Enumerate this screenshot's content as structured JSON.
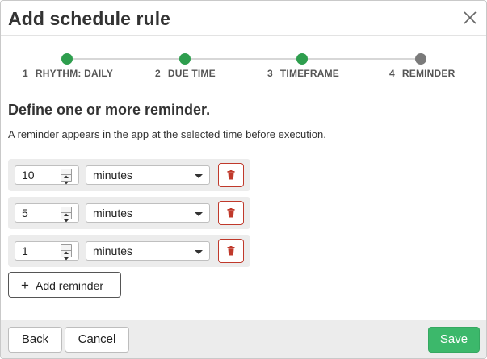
{
  "dialog": {
    "title": "Add schedule rule",
    "close_icon": "close-icon"
  },
  "stepper": {
    "steps": [
      {
        "number": "1",
        "label": "RHYTHM: DAILY",
        "status": "complete"
      },
      {
        "number": "2",
        "label": "DUE TIME",
        "status": "complete"
      },
      {
        "number": "3",
        "label": "TIMEFRAME",
        "status": "complete"
      },
      {
        "number": "4",
        "label": "REMINDER",
        "status": "current"
      }
    ],
    "colors": {
      "complete": "#2e9e4e",
      "current": "#7a7a7a",
      "line": "#d7d7d7"
    }
  },
  "content": {
    "heading": "Define one or more reminder.",
    "description": "A reminder appears in the app at the selected time before execution."
  },
  "reminders": [
    {
      "amount": "10",
      "unit": "minutes"
    },
    {
      "amount": "5",
      "unit": "minutes"
    },
    {
      "amount": "1",
      "unit": "minutes"
    }
  ],
  "add_reminder": {
    "icon": "plus-icon",
    "label": "Add reminder"
  },
  "footer": {
    "back_label": "Back",
    "cancel_label": "Cancel",
    "save_label": "Save"
  },
  "colors": {
    "accent": "#3cb86b",
    "danger": "#c0392b"
  }
}
